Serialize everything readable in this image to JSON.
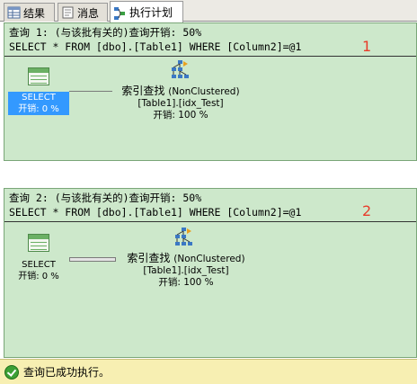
{
  "tabs": [
    {
      "label": "结果",
      "icon": "grid-icon",
      "active": false
    },
    {
      "label": "消息",
      "icon": "message-icon",
      "active": false
    },
    {
      "label": "执行计划",
      "icon": "execution-plan-icon",
      "active": true
    }
  ],
  "queries": [
    {
      "header": "查询 1: (与该批有关的)查询开销: 50%",
      "sql": "SELECT * FROM [dbo].[Table1] WHERE [Column2]=@1",
      "marker": "1",
      "select_node": {
        "label": "SELECT",
        "cost": "开销: 0 %",
        "selected": true
      },
      "seek_node": {
        "title": "索引查找",
        "type": "(NonClustered)",
        "object": "[Table1].[idx_Test]",
        "cost": "开销: 100 %"
      }
    },
    {
      "header": "查询 2: (与该批有关的)查询开销: 50%",
      "sql": "SELECT * FROM [dbo].[Table1] WHERE [Column2]=@1",
      "marker": "2",
      "select_node": {
        "label": "SELECT",
        "cost": "开销: 0 %",
        "selected": false
      },
      "seek_node": {
        "title": "索引查找",
        "type": "(NonClustered)",
        "object": "[Table1].[idx_Test]",
        "cost": "开销: 100 %"
      }
    }
  ],
  "status": {
    "text": "查询已成功执行。",
    "icon": "success-check-icon"
  },
  "colors": {
    "plan_background": "#cde8cb",
    "status_background": "#f7efb2",
    "selection": "#3399ff",
    "marker": "#e83c2a"
  }
}
